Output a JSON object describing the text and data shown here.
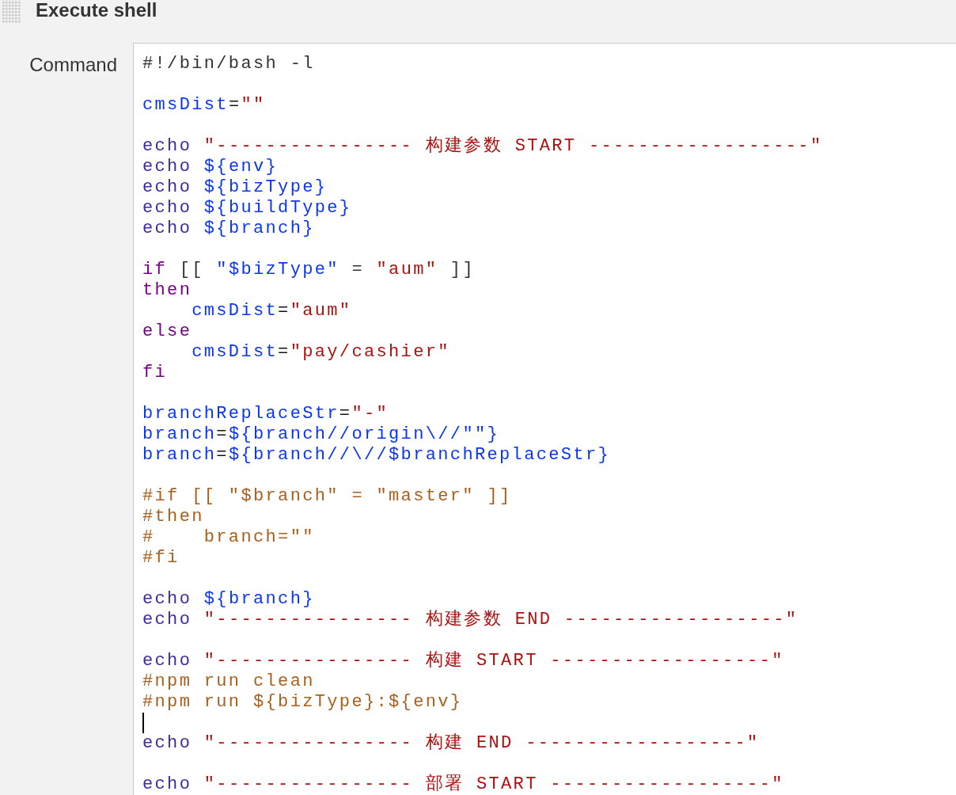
{
  "section": {
    "title": "Execute shell"
  },
  "command": {
    "label": "Command",
    "blocks": [
      {
        "lines": [
          {
            "tokens": [
              {
                "kind": "plain",
                "text": "#!/bin/bash -l"
              }
            ]
          }
        ]
      },
      {
        "lines": [
          {
            "tokens": [
              {
                "kind": "variable",
                "text": "cmsDist"
              },
              {
                "kind": "operator",
                "text": "="
              },
              {
                "kind": "string",
                "text": "\"\""
              }
            ]
          }
        ]
      },
      {
        "lines": [
          {
            "tokens": [
              {
                "kind": "builtin",
                "text": "echo"
              },
              {
                "kind": "string",
                "text": " \"---------------- 构建参数 START ------------------\""
              }
            ]
          },
          {
            "tokens": [
              {
                "kind": "builtin",
                "text": "echo"
              },
              {
                "kind": "variable",
                "text": " ${env}"
              }
            ]
          },
          {
            "tokens": [
              {
                "kind": "builtin",
                "text": "echo"
              },
              {
                "kind": "variable",
                "text": " ${bizType}"
              }
            ]
          },
          {
            "tokens": [
              {
                "kind": "builtin",
                "text": "echo"
              },
              {
                "kind": "variable",
                "text": " ${buildType}"
              }
            ]
          },
          {
            "tokens": [
              {
                "kind": "builtin",
                "text": "echo"
              },
              {
                "kind": "variable",
                "text": " ${branch}"
              }
            ]
          }
        ]
      },
      {
        "lines": [
          {
            "tokens": [
              {
                "kind": "keyword",
                "text": "if"
              },
              {
                "kind": "plain",
                "text": " [[ "
              },
              {
                "kind": "variable",
                "text": "\"$bizType\""
              },
              {
                "kind": "plain",
                "text": " = "
              },
              {
                "kind": "string",
                "text": "\"aum\""
              },
              {
                "kind": "plain",
                "text": " ]]"
              }
            ]
          },
          {
            "tokens": [
              {
                "kind": "keyword",
                "text": "then"
              }
            ]
          },
          {
            "tokens": [
              {
                "kind": "variable",
                "text": "    cmsDist"
              },
              {
                "kind": "operator",
                "text": "="
              },
              {
                "kind": "string",
                "text": "\"aum\""
              }
            ]
          },
          {
            "tokens": [
              {
                "kind": "keyword",
                "text": "else"
              }
            ]
          },
          {
            "tokens": [
              {
                "kind": "variable",
                "text": "    cmsDist"
              },
              {
                "kind": "operator",
                "text": "="
              },
              {
                "kind": "string",
                "text": "\"pay/cashier\""
              }
            ]
          },
          {
            "tokens": [
              {
                "kind": "keyword",
                "text": "fi"
              }
            ]
          }
        ]
      },
      {
        "lines": [
          {
            "tokens": [
              {
                "kind": "variable",
                "text": "branchReplaceStr"
              },
              {
                "kind": "operator",
                "text": "="
              },
              {
                "kind": "string",
                "text": "\"-\""
              }
            ]
          },
          {
            "tokens": [
              {
                "kind": "variable",
                "text": "branch"
              },
              {
                "kind": "operator",
                "text": "="
              },
              {
                "kind": "variable",
                "text": "${branch//origin\\//\"\"}"
              }
            ]
          },
          {
            "tokens": [
              {
                "kind": "variable",
                "text": "branch"
              },
              {
                "kind": "operator",
                "text": "="
              },
              {
                "kind": "variable",
                "text": "${branch//\\//$branchReplaceStr}"
              }
            ]
          }
        ]
      },
      {
        "lines": [
          {
            "tokens": [
              {
                "kind": "comment",
                "text": "#if [[ \"$branch\" = \"master\" ]]"
              }
            ]
          },
          {
            "tokens": [
              {
                "kind": "comment",
                "text": "#then"
              }
            ]
          },
          {
            "tokens": [
              {
                "kind": "comment",
                "text": "#    branch=\"\""
              }
            ]
          },
          {
            "tokens": [
              {
                "kind": "comment",
                "text": "#fi"
              }
            ]
          }
        ]
      },
      {
        "lines": [
          {
            "tokens": [
              {
                "kind": "builtin",
                "text": "echo"
              },
              {
                "kind": "variable",
                "text": " ${branch}"
              }
            ]
          },
          {
            "tokens": [
              {
                "kind": "builtin",
                "text": "echo"
              },
              {
                "kind": "string",
                "text": " \"---------------- 构建参数 END ------------------\""
              }
            ]
          }
        ]
      },
      {
        "caret_after": true,
        "lines": [
          {
            "tokens": [
              {
                "kind": "builtin",
                "text": "echo"
              },
              {
                "kind": "string",
                "text": " \"---------------- 构建 START ------------------\""
              }
            ]
          },
          {
            "tokens": [
              {
                "kind": "comment",
                "text": "#npm run clean"
              }
            ]
          },
          {
            "tokens": [
              {
                "kind": "comment",
                "text": "#npm run ${bizType}:${env}"
              }
            ]
          }
        ]
      },
      {
        "lines": [
          {
            "tokens": [
              {
                "kind": "builtin",
                "text": "echo"
              },
              {
                "kind": "string",
                "text": " \"---------------- 构建 END ------------------\""
              }
            ]
          }
        ]
      },
      {
        "lines": [
          {
            "tokens": [
              {
                "kind": "builtin",
                "text": "echo"
              },
              {
                "kind": "string",
                "text": " \"---------------- 部署 START ------------------\""
              }
            ]
          }
        ]
      }
    ]
  }
}
